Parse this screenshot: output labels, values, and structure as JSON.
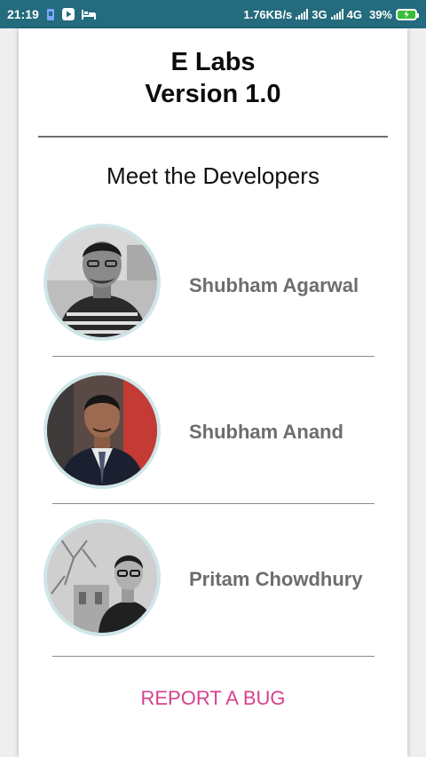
{
  "status_bar": {
    "time": "21:19",
    "net_speed": "1.76KB/s",
    "network_1": "3G",
    "network_2": "4G",
    "battery": "39%"
  },
  "app": {
    "name": "E Labs",
    "version": "Version 1.0"
  },
  "section": {
    "heading": "Meet the Developers"
  },
  "developers": [
    {
      "name": "Shubham Agarwal"
    },
    {
      "name": "Shubham Anand"
    },
    {
      "name": "Pritam Chowdhury"
    }
  ],
  "actions": {
    "report_bug": "REPORT A BUG"
  },
  "colors": {
    "status_bar": "#236b7d",
    "accent_link": "#d6418c",
    "avatar_ring": "#cfe6e8",
    "name_text": "#6d6d6d"
  },
  "icons": [
    "sim-icon",
    "play-store-icon",
    "bed-icon",
    "signal-icon",
    "battery-charging-icon"
  ]
}
